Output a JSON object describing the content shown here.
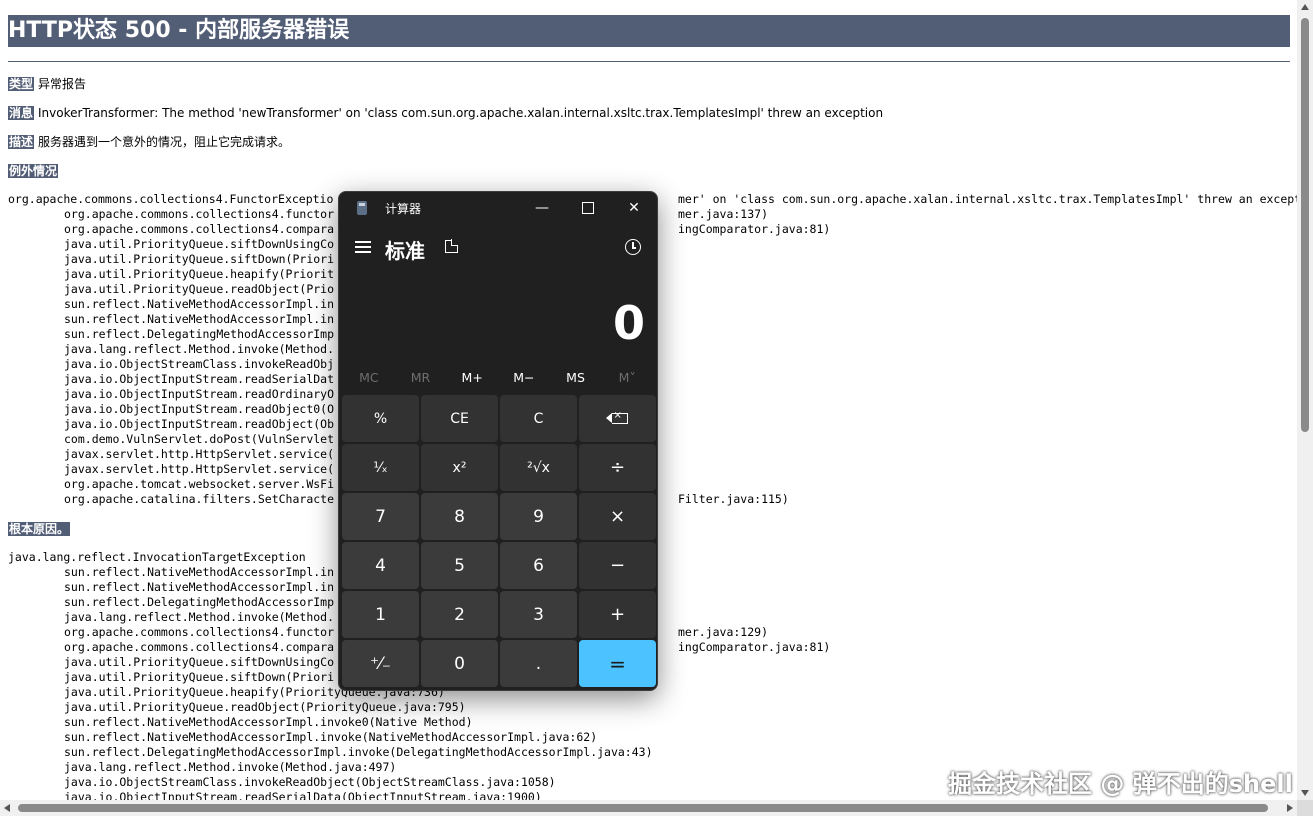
{
  "error_page": {
    "title": "HTTP状态 500 - 内部服务器错误",
    "type_label": "类型",
    "type_value": "异常报告",
    "message_label": "消息",
    "message_value": "InvokerTransformer: The method 'newTransformer' on 'class com.sun.org.apache.xalan.internal.xsltc.trax.TemplatesImpl' threw an exception",
    "desc_label": "描述",
    "desc_value": "服务器遇到一个意外的情况，阻止它完成请求。",
    "exception_label": "例外情况",
    "exception_lines": [
      "org.apache.commons.collections4.FunctorExceptio",
      "org.apache.commons.collections4.functor",
      "org.apache.commons.collections4.compara",
      "java.util.PriorityQueue.siftDownUsingCo",
      "java.util.PriorityQueue.siftDown(Priori",
      "java.util.PriorityQueue.heapify(Priorit",
      "java.util.PriorityQueue.readObject(Prio",
      "sun.reflect.NativeMethodAccessorImpl.in",
      "sun.reflect.NativeMethodAccessorImpl.in",
      "sun.reflect.DelegatingMethodAccessorImp",
      "java.lang.reflect.Method.invoke(Method.",
      "java.io.ObjectStreamClass.invokeReadObj",
      "java.io.ObjectInputStream.readSerialDat",
      "java.io.ObjectInputStream.readOrdinaryO",
      "java.io.ObjectInputStream.readObject0(O",
      "java.io.ObjectInputStream.readObject(Ob",
      "com.demo.VulnServlet.doPost(VulnServlet",
      "javax.servlet.http.HttpServlet.service(",
      "javax.servlet.http.HttpServlet.service(",
      "org.apache.tomcat.websocket.server.WsFi",
      "org.apache.catalina.filters.SetCharacte"
    ],
    "exception_right": [
      "mer' on 'class com.sun.org.apache.xalan.internal.xsltc.trax.TemplatesImpl' threw an exception",
      "mer.java:137)",
      "ingComparator.java:81)",
      "",
      "",
      "",
      "",
      "",
      "",
      "",
      "",
      "",
      "",
      "",
      "",
      "",
      "",
      "",
      "",
      "",
      "Filter.java:115)"
    ],
    "root_cause_label": "根本原因。",
    "root_cause_lines": [
      "java.lang.reflect.InvocationTargetException",
      "sun.reflect.NativeMethodAccessorImpl.in",
      "sun.reflect.NativeMethodAccessorImpl.in",
      "sun.reflect.DelegatingMethodAccessorImp",
      "java.lang.reflect.Method.invoke(Method.",
      "org.apache.commons.collections4.functor",
      "org.apache.commons.collections4.compara",
      "java.util.PriorityQueue.siftDownUsingCo",
      "java.util.PriorityQueue.siftDown(Priori",
      "java.util.PriorityQueue.heapify(PriorityQueue.java:736)",
      "java.util.PriorityQueue.readObject(PriorityQueue.java:795)",
      "sun.reflect.NativeMethodAccessorImpl.invoke0(Native Method)",
      "sun.reflect.NativeMethodAccessorImpl.invoke(NativeMethodAccessorImpl.java:62)",
      "sun.reflect.DelegatingMethodAccessorImpl.invoke(DelegatingMethodAccessorImpl.java:43)",
      "java.lang.reflect.Method.invoke(Method.java:497)",
      "java.io.ObjectStreamClass.invokeReadObject(ObjectStreamClass.java:1058)",
      "java.io.ObjectInputStream.readSerialData(ObjectInputStream.java:1900)"
    ],
    "root_cause_right": [
      "",
      "",
      "",
      "",
      "",
      "mer.java:129)",
      "ingComparator.java:81)",
      "",
      "",
      "",
      "",
      "",
      "",
      "",
      "",
      "",
      ""
    ]
  },
  "calculator": {
    "window_title": "计算器",
    "mode": "标准",
    "display": "0",
    "memory": [
      "MC",
      "MR",
      "M+",
      "M−",
      "MS",
      "M˅"
    ],
    "keys": [
      {
        "label": "%",
        "kind": "fn",
        "name": "percent"
      },
      {
        "label": "CE",
        "kind": "fn",
        "name": "clear-entry"
      },
      {
        "label": "C",
        "kind": "fn",
        "name": "clear"
      },
      {
        "label": "",
        "kind": "fn",
        "name": "backspace"
      },
      {
        "label": "¹⁄ₓ",
        "kind": "fn",
        "name": "reciprocal"
      },
      {
        "label": "x²",
        "kind": "fn",
        "name": "square"
      },
      {
        "label": "²√x",
        "kind": "fn",
        "name": "square-root"
      },
      {
        "label": "÷",
        "kind": "op",
        "name": "divide"
      },
      {
        "label": "7",
        "kind": "num",
        "name": "digit-7"
      },
      {
        "label": "8",
        "kind": "num",
        "name": "digit-8"
      },
      {
        "label": "9",
        "kind": "num",
        "name": "digit-9"
      },
      {
        "label": "×",
        "kind": "op",
        "name": "multiply"
      },
      {
        "label": "4",
        "kind": "num",
        "name": "digit-4"
      },
      {
        "label": "5",
        "kind": "num",
        "name": "digit-5"
      },
      {
        "label": "6",
        "kind": "num",
        "name": "digit-6"
      },
      {
        "label": "−",
        "kind": "op",
        "name": "subtract"
      },
      {
        "label": "1",
        "kind": "num",
        "name": "digit-1"
      },
      {
        "label": "2",
        "kind": "num",
        "name": "digit-2"
      },
      {
        "label": "3",
        "kind": "num",
        "name": "digit-3"
      },
      {
        "label": "+",
        "kind": "op",
        "name": "add"
      },
      {
        "label": "⁺⁄₋",
        "kind": "num",
        "name": "negate"
      },
      {
        "label": "0",
        "kind": "num",
        "name": "digit-0"
      },
      {
        "label": ".",
        "kind": "num",
        "name": "decimal"
      },
      {
        "label": "=",
        "kind": "eq",
        "name": "equals"
      }
    ],
    "accent_color": "#4cc2ff"
  },
  "watermark": "掘金技术社区 @ 弹不出的shell",
  "colors": {
    "header_bg": "#525d76",
    "calc_bg": "#202020"
  }
}
